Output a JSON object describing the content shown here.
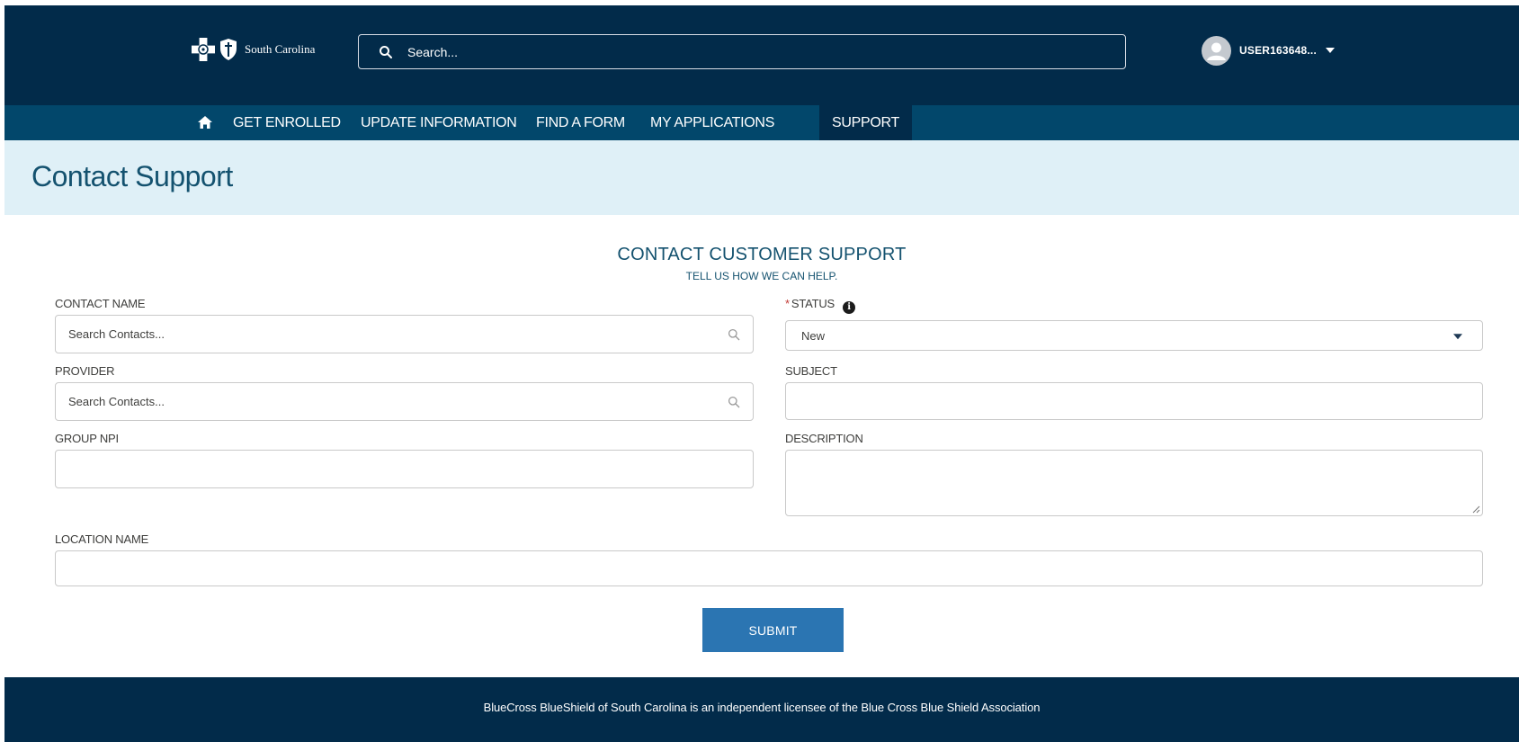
{
  "header": {
    "brand": "South Carolina",
    "search_placeholder": "Search...",
    "username": "USER163648..."
  },
  "nav": {
    "items": [
      {
        "label": "GET ENROLLED"
      },
      {
        "label": "UPDATE INFORMATION"
      },
      {
        "label": "FIND A FORM"
      },
      {
        "label": "MY APPLICATIONS"
      },
      {
        "label": "SUPPORT",
        "active": true
      }
    ]
  },
  "page": {
    "title": "Contact Support"
  },
  "form": {
    "title": "CONTACT CUSTOMER SUPPORT",
    "subtitle": "TELL US HOW WE CAN HELP.",
    "contact_name_label": "CONTACT NAME",
    "contact_name_placeholder": "Search Contacts...",
    "provider_label": "PROVIDER",
    "provider_placeholder": "Search Contacts...",
    "group_npi_label": "GROUP NPI",
    "status_label": "STATUS",
    "status_required_mark": "*",
    "status_value": "New",
    "subject_label": "SUBJECT",
    "description_label": "DESCRIPTION",
    "location_name_label": "LOCATION NAME",
    "submit_label": "SUBMIT"
  },
  "footer": {
    "text": "BlueCross BlueShield of South Carolina is an independent licensee of the Blue Cross Blue Shield Association"
  },
  "colors": {
    "header_bg": "#022b4a",
    "nav_bg": "#02476b",
    "band_bg": "#dff0f7",
    "title_text": "#14526f",
    "submit_bg": "#2b75b2"
  },
  "icons": [
    "bcbs-cross-logo",
    "bcbs-shield-logo",
    "search-icon",
    "avatar-icon",
    "chevron-down-icon",
    "home-icon",
    "info-icon",
    "magnifier-icon",
    "resize-handle-icon"
  ]
}
